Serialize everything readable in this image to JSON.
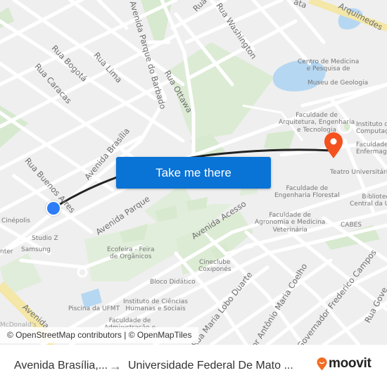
{
  "map": {
    "streets": [
      {
        "id": "rua-bogota",
        "text": "Rua Bogotá"
      },
      {
        "id": "rua-lima",
        "text": "Rua Lima"
      },
      {
        "id": "rua-caracas",
        "text": "Rua Caracas"
      },
      {
        "id": "avenida-parque-do-barbado",
        "text": "Avenida Parque do Barbado"
      },
      {
        "id": "rua-ottawa",
        "text": "Rua Ottawa"
      },
      {
        "id": "rua-washington",
        "text": "Rua Washington"
      },
      {
        "id": "rua-top",
        "text": "Rua"
      },
      {
        "id": "rua-arquimedes",
        "text": "Arquimedes"
      },
      {
        "id": "rua-ata",
        "text": "ata"
      },
      {
        "id": "avenida-brasilia",
        "text": "Avenida Brasília"
      },
      {
        "id": "rua-buenos-aires",
        "text": "Rua Buenos Aires"
      },
      {
        "id": "avenida-parque-2",
        "text": "Avenida Parque"
      },
      {
        "id": "avenida-acesso",
        "text": "Avenida Acesso"
      },
      {
        "id": "rua-maria-lobo-duarte",
        "text": "Rua Maria Lobo Duarte"
      },
      {
        "id": "rua-antonio-maria-coelho",
        "text": "or Antônio Maria Coelho"
      },
      {
        "id": "rua-governador-frederico-campos",
        "text": "Governador Frederico Campos"
      },
      {
        "id": "rua-gov",
        "text": "Rua Gove"
      },
      {
        "id": "avenida-bottom",
        "text": "Avenida"
      }
    ],
    "pois": [
      {
        "id": "centro-medicina",
        "text": "Centro de Medicina\ne Pesquisa de"
      },
      {
        "id": "museu-geologia",
        "text": "Museu de Geologia"
      },
      {
        "id": "faculdade-arquitetura",
        "text": "Faculdade de\nArquitetura, Engenharia\ne Tecnologia"
      },
      {
        "id": "instituto-computacao",
        "text": "Instituto d\nComputaçã"
      },
      {
        "id": "faculdade-enfermagem",
        "text": "Faculdade d\nEnfermage"
      },
      {
        "id": "teatro-universitario",
        "text": "Teatro Universitário"
      },
      {
        "id": "faculdade-eng-florestal",
        "text": "Faculdade de\nEngenharia Florestal"
      },
      {
        "id": "biblioteca-central",
        "text": "Bibliotec\nCentral da U"
      },
      {
        "id": "faculdade-agronomia",
        "text": "Faculdade de\nAgronomia e Medicina\nVeterinária"
      },
      {
        "id": "cabes",
        "text": "CABES"
      },
      {
        "id": "cinepolis",
        "text": "Cinépolis"
      },
      {
        "id": "studio-z",
        "text": "Studio Z"
      },
      {
        "id": "samsung",
        "text": "Samsung"
      },
      {
        "id": "nter",
        "text": "nter"
      },
      {
        "id": "ecofeira",
        "text": "Ecofeira - Feira\nde Orgânicos"
      },
      {
        "id": "cineclube",
        "text": "Cineclube\nCoxiponés"
      },
      {
        "id": "bloco-didatico",
        "text": "Bloco Didático"
      },
      {
        "id": "instituto-ciencias",
        "text": "Instituto de Ciências\nHumanas e Sociais"
      },
      {
        "id": "piscina-ufmt",
        "text": "Piscina da UFMT"
      },
      {
        "id": "faculdade-administracao",
        "text": "Faculdade de\nAdministração e"
      },
      {
        "id": "mcdonalds",
        "text": "McDonald's"
      }
    ],
    "origin_marker": {
      "color": "#2f7df6"
    },
    "destination_marker": {
      "color": "#f4511e"
    },
    "route_color": "#222222"
  },
  "cta": {
    "label": "Take me there"
  },
  "attribution": {
    "text": "© OpenStreetMap contributors | © OpenMapTiles"
  },
  "footer": {
    "from": "Avenida Brasília,...",
    "arrow": "→",
    "to": "Universidade Federal De Mato ...",
    "logo": "moovit",
    "logo_color": "#f26c22"
  }
}
